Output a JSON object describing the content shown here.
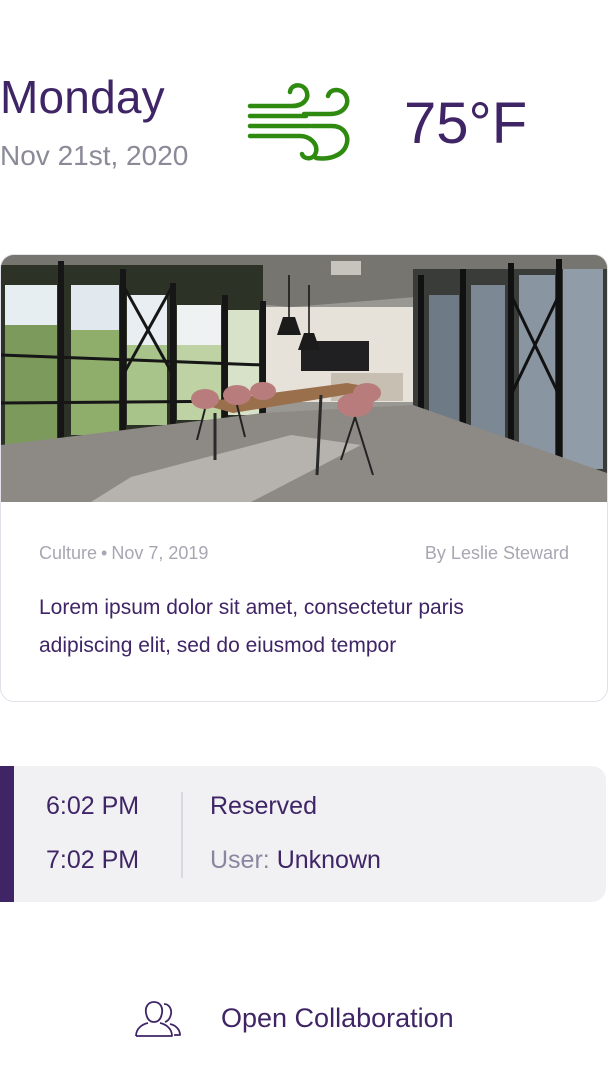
{
  "header": {
    "day": "Monday",
    "date": "Nov 21st, 2020",
    "weather_icon": "wind-icon",
    "temperature": "75°F"
  },
  "article": {
    "category": "Culture",
    "separator": "•",
    "published": "Nov 7, 2019",
    "author": "By Leslie Steward",
    "excerpt": "Lorem ipsum dolor sit amet, consectetur paris adipiscing elit, sed do eiusmod tempor"
  },
  "booking": {
    "start_time": "6:02 PM",
    "end_time": "7:02 PM",
    "status": "Reserved",
    "user_label": "User:",
    "user_value": "Unknown"
  },
  "footer": {
    "action_icon": "users-icon",
    "action_label": "Open Collaboration"
  },
  "colors": {
    "primary": "#3f2566",
    "muted": "#8a8a98",
    "weather_green": "#2e8b10",
    "booking_bg": "#f1f1f3"
  }
}
